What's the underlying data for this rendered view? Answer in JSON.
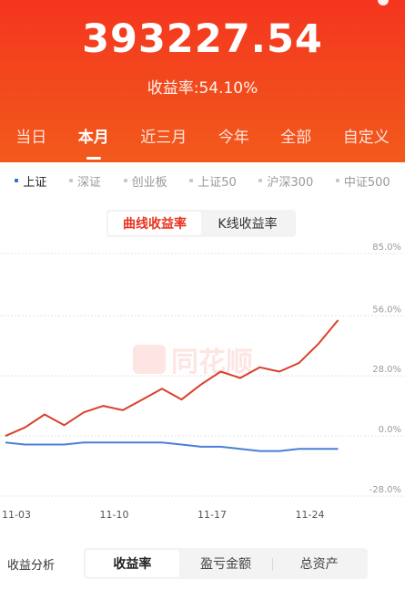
{
  "header": {
    "amount": "393227.54",
    "rate_label": "收益率:54.10%"
  },
  "period_tabs": [
    {
      "label": "当日",
      "active": false
    },
    {
      "label": "本月",
      "active": true
    },
    {
      "label": "近三月",
      "active": false
    },
    {
      "label": "今年",
      "active": false
    },
    {
      "label": "全部",
      "active": false
    },
    {
      "label": "自定义",
      "active": false
    }
  ],
  "index_tabs": [
    {
      "label": "上证",
      "active": true
    },
    {
      "label": "深证",
      "active": false
    },
    {
      "label": "创业板",
      "active": false
    },
    {
      "label": "上证50",
      "active": false
    },
    {
      "label": "沪深300",
      "active": false
    },
    {
      "label": "中证500",
      "active": false
    }
  ],
  "chart_tabs": [
    {
      "label": "曲线收益率",
      "active": true
    },
    {
      "label": "K线收益率",
      "active": false
    }
  ],
  "watermark": "同花顺",
  "colors": {
    "brand_red": "#e8321e",
    "header_red": "#f4401e",
    "benchmark_blue": "#4a7fd8",
    "tab_active_blue": "#2f6fd6"
  },
  "chart_data": {
    "type": "line",
    "y_ticks": [
      "85.0%",
      "56.0%",
      "28.0%",
      "0.0%",
      "-28.0%"
    ],
    "y_tick_values": [
      85,
      56,
      28,
      0,
      -28
    ],
    "ylim": [
      -28,
      85
    ],
    "x_ticks": [
      {
        "label": "11-03",
        "at": 0
      },
      {
        "label": "11-10",
        "at": 5
      },
      {
        "label": "11-17",
        "at": 10
      },
      {
        "label": "11-24",
        "at": 15
      }
    ],
    "x_count": 17,
    "series": [
      {
        "color": "#d9402b",
        "values": [
          0,
          4,
          10,
          5,
          11,
          14,
          12,
          17,
          22,
          17,
          24,
          30,
          27,
          32,
          30,
          34,
          43,
          54
        ]
      },
      {
        "color": "#4a7fd8",
        "values": [
          -3,
          -4,
          -4,
          -4,
          -3,
          -3,
          -3,
          -3,
          -3,
          -4,
          -5,
          -5,
          -6,
          -7,
          -7,
          -6,
          -6,
          -6
        ]
      }
    ]
  },
  "bottom": {
    "label": "收益分析",
    "tabs": [
      {
        "label": "收益率",
        "active": true
      },
      {
        "label": "盈亏金额",
        "active": false
      },
      {
        "label": "总资产",
        "active": false
      }
    ]
  }
}
